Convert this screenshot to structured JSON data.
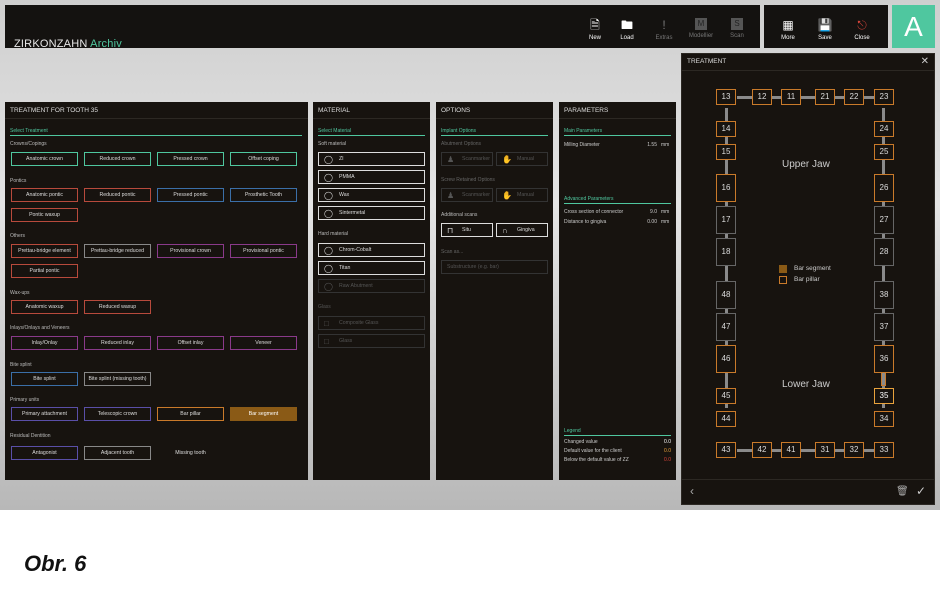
{
  "app": {
    "brand_main": "ZIRKONZAHN",
    "brand_accent": "Archiv",
    "avatar_letter": "A"
  },
  "toolbar": [
    {
      "label": "New",
      "icon": "new-file-icon",
      "dim": false
    },
    {
      "label": "Load",
      "icon": "folder-icon",
      "dim": false
    },
    {
      "label": "Extras",
      "icon": "exclamation-icon",
      "dim": true
    },
    {
      "label": "Modellier",
      "icon": "modellier-icon",
      "dim": true
    },
    {
      "label": "Scan",
      "icon": "scan-icon",
      "dim": true
    }
  ],
  "toolbar2": [
    {
      "label": "More",
      "icon": "more-icon"
    },
    {
      "label": "Save",
      "icon": "save-icon"
    },
    {
      "label": "Close",
      "icon": "close-icon"
    }
  ],
  "treatment": {
    "title": "TREATMENT FOR TOOTH 35",
    "select": "Select Treatment",
    "groups": [
      {
        "label": "Crowns/Copings",
        "items": [
          "Anatomic crown",
          "Reduced crown",
          "Pressed crown",
          "Offset coping"
        ]
      },
      {
        "label": "Pontics",
        "items": [
          "Anatomic pontic",
          "Reduced pontic",
          "Pressed pontic",
          "Prosthetic Tooth",
          "Pontic waxup"
        ]
      },
      {
        "label": "Others",
        "items": [
          "Prettau-bridge element",
          "Prettau-bridge reduced",
          "Provisional crown",
          "Provisional pontic",
          "Partial pontic"
        ]
      },
      {
        "label": "Wax-ups",
        "items": [
          "Anatomic waxup",
          "Reduced waxup"
        ]
      },
      {
        "label": "Inlays/Onlays and Veneers",
        "items": [
          "Inlay/Onlay",
          "Reduced inlay",
          "Offset inlay",
          "Veneer"
        ]
      },
      {
        "label": "Bite splint",
        "items": [
          "Bite splint",
          "Bite splint (missing tooth)"
        ]
      },
      {
        "label": "Primary units",
        "items": [
          "Primary attachment",
          "Telescopic crown",
          "Bar pillar",
          "Bar segment"
        ]
      },
      {
        "label": "Residual Dentition",
        "items": [
          "Antagonist",
          "Adjacent tooth",
          "Missing tooth"
        ]
      }
    ]
  },
  "material": {
    "title": "MATERIAL",
    "select": "Select Material",
    "soft_label": "Soft material",
    "soft": [
      "ZI",
      "PMMA",
      "Wax",
      "Sintermetal"
    ],
    "hard_label": "Hard material",
    "hard": [
      "Chrom-Cobalt",
      "Titan",
      "Raw Abutment"
    ],
    "glass_label": "Glass",
    "glass": [
      "Composite Glass",
      "Glass"
    ]
  },
  "options": {
    "title": "OPTIONS",
    "implant": "Implant Options",
    "abutment_label": "Abutment Options",
    "abutment": [
      "Scanmarker",
      "Manual"
    ],
    "screw_label": "Screw Retained Options",
    "screw": [
      "Scanmarker",
      "Manual"
    ],
    "scans_label": "Additional scans",
    "scans": [
      "Situ",
      "Gingiva"
    ],
    "scanas_label": "Scan as...",
    "scanas_placeholder": "Substructure (e.g. bar)"
  },
  "parameters": {
    "title": "PARAMETERS",
    "main": "Main Parameters",
    "milling_label": "Milling Diameter",
    "milling_value": "1.55",
    "milling_unit": "mm",
    "advanced": "Advanced Parameters",
    "cross_label": "Cross section of connector",
    "cross_value": "9.0",
    "cross_unit": "mm",
    "dist_label": "Distance to gingiva",
    "dist_value": "0.00",
    "dist_unit": "mm",
    "legend": "Legend",
    "legend_items": [
      {
        "label": "Changed value",
        "value": "0.0",
        "color": "#ffffff"
      },
      {
        "label": "Default value for the client",
        "value": "0.0",
        "color": "#e8a23c"
      },
      {
        "label": "Below the default value of ZZ",
        "value": "0.0",
        "color": "#d9443a"
      }
    ]
  },
  "teeth_panel": {
    "title": "TREATMENT",
    "upper_jaw": "Upper Jaw",
    "lower_jaw": "Lower Jaw",
    "legend": [
      "Bar segment",
      "Bar pillar"
    ],
    "selected_tooth": "35",
    "upper_row": [
      "13",
      "12",
      "11",
      "21",
      "22",
      "23"
    ],
    "lower_row": [
      "43",
      "42",
      "41",
      "31",
      "32",
      "33"
    ],
    "left_upper": [
      "14",
      "15",
      "16",
      "17",
      "18"
    ],
    "right_upper": [
      "24",
      "25",
      "26",
      "27",
      "28"
    ],
    "left_lower": [
      "48",
      "47",
      "46",
      "45",
      "44"
    ],
    "right_lower": [
      "38",
      "37",
      "36",
      "35",
      "34"
    ]
  },
  "caption": "Obr. 6",
  "colors": {
    "accent": "#4fc79f",
    "bar_segment": "#8a5a16",
    "bar_pillar": "#c97a2a",
    "panel": "#17130f"
  }
}
